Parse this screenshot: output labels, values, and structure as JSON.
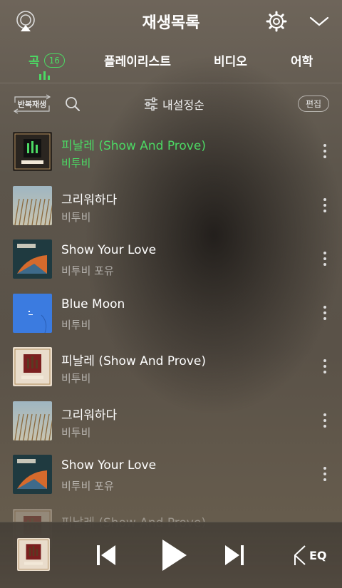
{
  "header": {
    "title": "재생목록"
  },
  "tabs": [
    {
      "label": "곡",
      "count": "16"
    },
    {
      "label": "플레이리스트"
    },
    {
      "label": "비디오"
    },
    {
      "label": "어학"
    }
  ],
  "toolbar": {
    "repeat_label": "반복재생",
    "sort_label": "내설정순",
    "edit_label": "편집"
  },
  "songs": [
    {
      "title": "피날레 (Show And Prove)",
      "artist": "비투비",
      "art": "finale-dark",
      "playing": true
    },
    {
      "title": "그리워하다",
      "artist": "비투비",
      "art": "reeds"
    },
    {
      "title": "Show Your Love",
      "artist": "비투비 포유",
      "art": "inside"
    },
    {
      "title": "Blue Moon",
      "artist": "비투비",
      "art": "blue"
    },
    {
      "title": "피날레 (Show And Prove)",
      "artist": "비투비",
      "art": "finale-light"
    },
    {
      "title": "그리워하다",
      "artist": "비투비",
      "art": "reeds"
    },
    {
      "title": "Show Your Love",
      "artist": "비투비 포유",
      "art": "inside"
    },
    {
      "title": "피날레 (Show And Prove)",
      "artist": "",
      "art": "finale-light"
    }
  ],
  "player": {
    "eq_label": "EQ"
  },
  "colors": {
    "accent": "#4cd964"
  }
}
